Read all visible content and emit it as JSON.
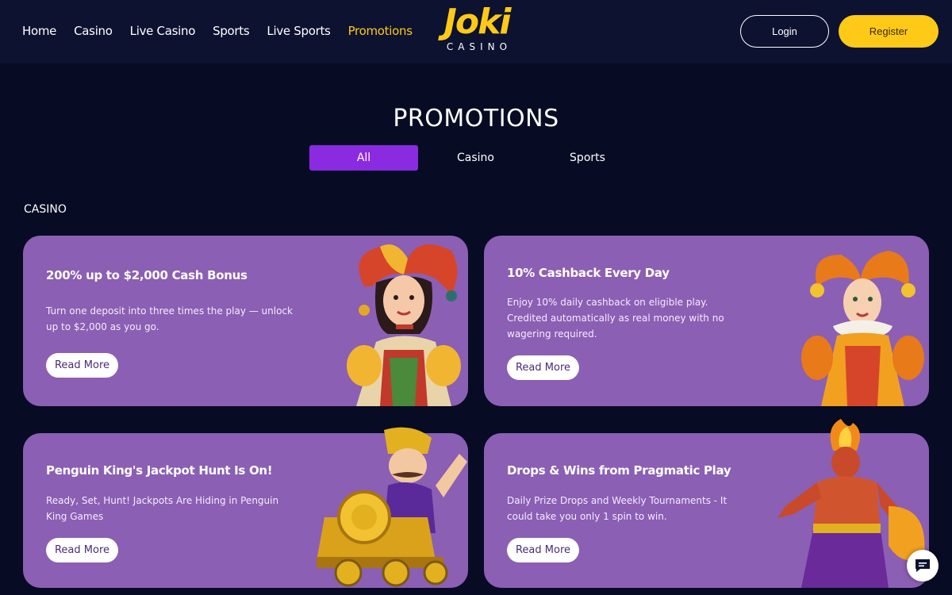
{
  "header": {
    "nav": [
      {
        "label": "Home",
        "active": false
      },
      {
        "label": "Casino",
        "active": false
      },
      {
        "label": "Live Casino",
        "active": false
      },
      {
        "label": "Sports",
        "active": false
      },
      {
        "label": "Live Sports",
        "active": false
      },
      {
        "label": "Promotions",
        "active": true
      }
    ],
    "logo_word": "Joki",
    "logo_sub": "CASINO",
    "login_label": "Login",
    "register_label": "Register"
  },
  "page": {
    "title": "PROMOTIONS",
    "tabs": [
      {
        "label": "All",
        "active": true
      },
      {
        "label": "Casino",
        "active": false
      },
      {
        "label": "Sports",
        "active": false
      }
    ],
    "section_label": "CASINO"
  },
  "promotions": [
    {
      "title": "200% up to $2,000 Cash Bonus",
      "description": "Turn one deposit into three times the play — unlock up to $2,000 as you go.",
      "button": "Read More",
      "art": "jester-girl-illustration"
    },
    {
      "title": "10% Cashback Every Day",
      "description": "Enjoy 10% daily cashback on eligible play. Credited automatically as real money with no wagering required.",
      "button": "Read More",
      "art": "harlequin-woman-illustration"
    },
    {
      "title": "Penguin King's Jackpot Hunt Is On!",
      "description": "Ready, Set, Hunt! Jackpots Are Hiding in Penguin King Games",
      "button": "Read More",
      "art": "train-conductor-illustration"
    },
    {
      "title": "Drops & Wins from Pragmatic Play",
      "description": "Daily Prize Drops and Weekly Tournaments - It could take you only 1 spin to win.",
      "button": "Read More",
      "art": "fire-warrior-illustration"
    }
  ],
  "colors": {
    "background": "#070b24",
    "header": "#0c1230",
    "accent_yellow": "#ffc918",
    "tab_active": "#8a2be2",
    "card": "#8b5fb3"
  },
  "chat_icon": "chat-bubble-icon"
}
